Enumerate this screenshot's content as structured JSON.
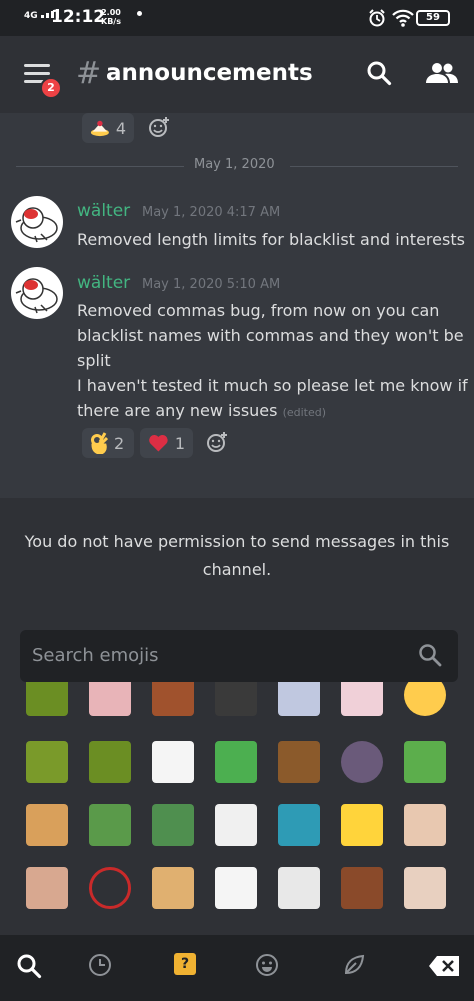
{
  "status_bar": {
    "network": "4G",
    "time": "12:12",
    "speed_value": "2.00",
    "speed_unit": "KB/s",
    "battery": "59"
  },
  "header": {
    "notification_count": "2",
    "hash": "#",
    "channel_name": "announcements"
  },
  "prev_reaction": {
    "emoji": "cake-icon",
    "count": "4"
  },
  "date_divider": "May 1, 2020",
  "messages": [
    {
      "author": "wälter",
      "timestamp": "May 1, 2020 4:17 AM",
      "lines": [
        "Removed length limits for blacklist and interests"
      ]
    },
    {
      "author": "wälter",
      "timestamp": "May 1, 2020 5:10 AM",
      "lines": [
        "Removed commas bug, from now on you can",
        "blacklist names with commas and they won't be",
        "split",
        "I haven't tested it much so please let me know if",
        "there are any new issues"
      ],
      "edited": "(edited)",
      "reactions": [
        {
          "emoji": "ok-hand-icon",
          "count": "2"
        },
        {
          "emoji": "heart-icon",
          "count": "1"
        }
      ]
    }
  ],
  "permission_notice": "You do not have permission to send messages in this channel.",
  "emoji_search": {
    "placeholder": "Search emojis"
  },
  "colors": {
    "accent_green": "#43b581",
    "badge_red": "#ed4245",
    "background": "#36393f",
    "panel": "#2f3136"
  }
}
